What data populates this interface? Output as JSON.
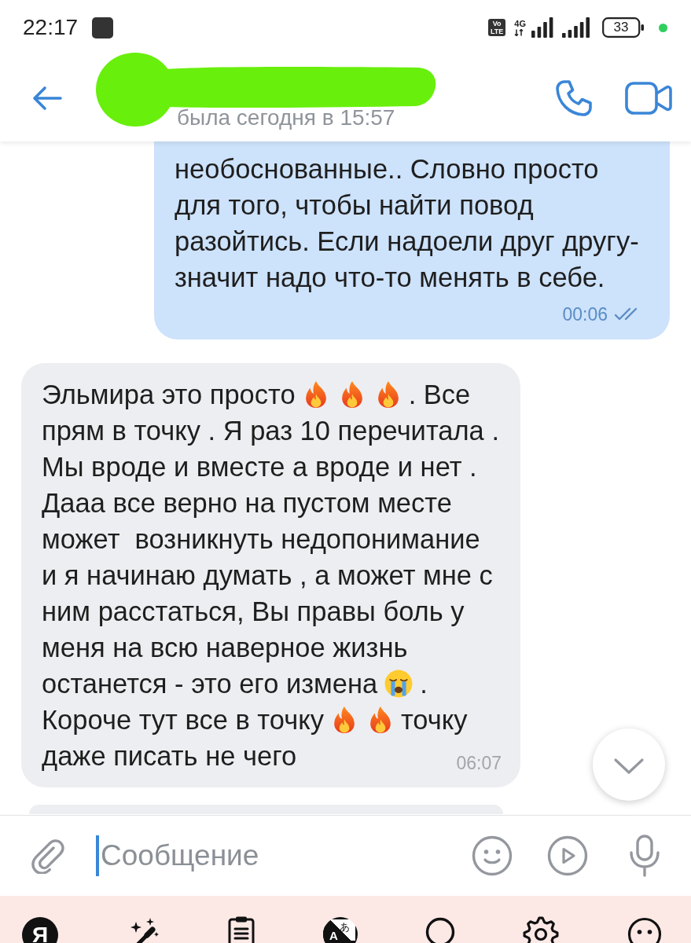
{
  "status_bar": {
    "time": "22:17",
    "volte": [
      "Vo",
      "LTE"
    ],
    "network": "4G",
    "battery": "33"
  },
  "header": {
    "contact_name_redacted": true,
    "last_seen": "была сегодня в 15:57"
  },
  "messages": [
    {
      "kind": "outgoing",
      "lines": [
        [
          {
            "kind": "text",
            "text": "необоснованные.. Словно просто"
          }
        ],
        [
          {
            "kind": "text",
            "text": "для того, чтобы найти повод"
          }
        ],
        [
          {
            "kind": "text",
            "text": "разойтись. Если надоели друг другу-"
          }
        ],
        [
          {
            "kind": "text",
            "text": "значит надо что-то менять в себе."
          }
        ]
      ],
      "time": "00:06",
      "read": true
    },
    {
      "kind": "incoming",
      "lines": [
        [
          {
            "kind": "text",
            "text": "Эльмира это просто"
          },
          {
            "kind": "fire"
          },
          {
            "kind": "fire"
          },
          {
            "kind": "fire"
          },
          {
            "kind": "text",
            "text": ". Все"
          }
        ],
        [
          {
            "kind": "text",
            "text": "прям в точку . Я раз 10 перечитала ."
          }
        ],
        [
          {
            "kind": "text",
            "text": "Мы вроде и вместе а вроде и нет ."
          }
        ],
        [
          {
            "kind": "text",
            "text": "Дааа все верно на пустом месте"
          }
        ],
        [
          {
            "kind": "text",
            "text": "может  возникнуть недопонимание"
          }
        ],
        [
          {
            "kind": "text",
            "text": "и я начинаю думать , а может мне с"
          }
        ],
        [
          {
            "kind": "text",
            "text": "ним расстаться, Вы правы боль у"
          }
        ],
        [
          {
            "kind": "text",
            "text": "меня на всю наверное жизнь"
          }
        ],
        [
          {
            "kind": "text",
            "text": "останется - это его измена"
          },
          {
            "kind": "crying"
          },
          {
            "kind": "text",
            "text": "."
          }
        ],
        [
          {
            "kind": "text",
            "text": "Короче тут все в точку"
          },
          {
            "kind": "fire"
          },
          {
            "kind": "fire"
          },
          {
            "kind": "text",
            "text": "точку"
          }
        ],
        [
          {
            "kind": "text",
            "text": "даже писать не чего"
          }
        ]
      ],
      "time": "06:07"
    },
    {
      "kind": "incoming"
    }
  ],
  "composer": {
    "placeholder": "Сообщение",
    "focused": true
  },
  "keyboard_toolbar": {
    "logo": "Я",
    "translate": [
      "A",
      "あ"
    ]
  }
}
